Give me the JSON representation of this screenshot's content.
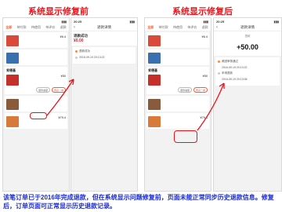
{
  "headings": {
    "before": "系统显示修复前",
    "after": "系统显示修复后"
  },
  "orders_list": {
    "time_left": "",
    "time_right": "",
    "tabs": [
      "全部",
      "待付款",
      "待使用",
      "待评价",
      "退款"
    ],
    "orders": [
      {
        "shop": "",
        "status": "",
        "title": "",
        "price": "¥6.4",
        "color": "#d94a3a"
      },
      {
        "shop": "",
        "status": "",
        "title": "",
        "price": "",
        "color": "#3a6fb0"
      },
      {
        "shop": "肯德基",
        "status": "",
        "title": "",
        "price": "¥50",
        "color": "#c5302b"
      },
      {
        "shop": "",
        "status": "",
        "title": "",
        "price": "",
        "color": "#8a5a3c"
      },
      {
        "shop": "",
        "status": "",
        "title": "",
        "price": "¥79.4",
        "color": "#d77a3a"
      }
    ],
    "buttons": {
      "refund_progress": "退款进度",
      "more": "再来一单"
    }
  },
  "detail_left": {
    "time": "20:25",
    "nav_title": "退款详情",
    "status": "退款成功",
    "amount": "¥0.00",
    "timeline": [
      {
        "text": "退款成功"
      },
      {
        "text": "2016-09-19 20:13:22"
      }
    ]
  },
  "detail_right": {
    "time": "20:25",
    "nav_title": "退款详情",
    "label": "退款",
    "amount": "+50.00",
    "timeline": [
      {
        "text": "美团审核通过"
      },
      {
        "text": "2016-09-19 20:13:22"
      },
      {
        "text": "申请退款"
      },
      {
        "text": "2016-09-19 20:13:08"
      }
    ]
  },
  "orders_list_right": {
    "highlight_button": "退款进度"
  },
  "footer": "该笔订单已于2016年完成退款，但在系统显示问题修复前，页面未能正常同步历史退款信息。修复后，订单页面可正常显示历史退款记录。",
  "accent_color": "#e8141b",
  "brand_color": "#ff5a2a"
}
